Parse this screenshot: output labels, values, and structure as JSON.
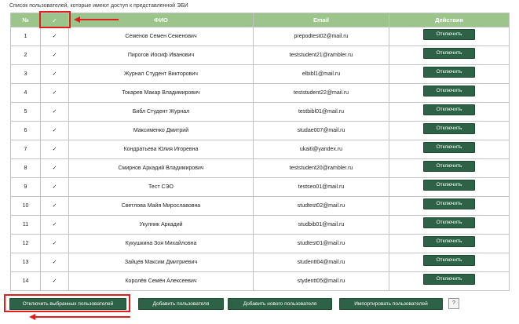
{
  "caption": "Список пользователей, которые имеют доступ к представленной ЭБИ",
  "table": {
    "headers": {
      "num": "№",
      "select_all": "✓",
      "fio": "ФИО",
      "email": "Email",
      "actions": "Действия"
    },
    "rows": [
      {
        "num": "1",
        "checked": "✓",
        "fio": "Семенов Семен Семенович",
        "email": "prepodtest02@mail.ru",
        "action": "Отключить"
      },
      {
        "num": "2",
        "checked": "✓",
        "fio": "Пирогов Иосиф Иванович",
        "email": "teststudent21@rambler.ru",
        "action": "Отключить"
      },
      {
        "num": "3",
        "checked": "✓",
        "fio": "Журнал Студент Викторович",
        "email": "elbibl1@mail.ru",
        "action": "Отключить"
      },
      {
        "num": "4",
        "checked": "✓",
        "fio": "Токарев Макар Владимирович",
        "email": "teststudent22@mail.ru",
        "action": "Отключить"
      },
      {
        "num": "5",
        "checked": "✓",
        "fio": "Библ Студент Журнал",
        "email": "testbibl01@mail.ru",
        "action": "Отключить"
      },
      {
        "num": "6",
        "checked": "✓",
        "fio": "Максименко Дмитрий",
        "email": "studae007@mail.ru",
        "action": "Отключить"
      },
      {
        "num": "7",
        "checked": "✓",
        "fio": "Кондратьева Юлия Игоревна",
        "email": "ukaiti@yandex.ru",
        "action": "Отключить"
      },
      {
        "num": "8",
        "checked": "✓",
        "fio": "Смирнов Аркадий Владимирович",
        "email": "teststudent20@rambler.ru",
        "action": "Отключить"
      },
      {
        "num": "9",
        "checked": "✓",
        "fio": "Тест СЭО",
        "email": "testseo01@mail.ru",
        "action": "Отключить"
      },
      {
        "num": "10",
        "checked": "✓",
        "fio": "Светлова Майя Мирославовна",
        "email": "studtest02@mail.ru",
        "action": "Отключить"
      },
      {
        "num": "11",
        "checked": "✓",
        "fio": "Укулник Аркадий",
        "email": "studbib01@mail.ru",
        "action": "Отключить"
      },
      {
        "num": "12",
        "checked": "✓",
        "fio": "Кукушкина Зоя Михайловна",
        "email": "studtest01@mail.ru",
        "action": "Отключить"
      },
      {
        "num": "13",
        "checked": "✓",
        "fio": "Зайцев Максим Дмитриевич",
        "email": "studentt04@mail.ru",
        "action": "Отключить"
      },
      {
        "num": "14",
        "checked": "✓",
        "fio": "Королёв Семён Алексеевич",
        "email": "stydentt05@mail.ru",
        "action": "Отключить"
      }
    ]
  },
  "bottom_buttons": {
    "disable_selected": "Отключить выбранных пользователей",
    "add_user": "Добавить пользователя",
    "add_new_user": "Добавить нового пользователя",
    "import_users": "Импортировать пользователей",
    "help": "?"
  },
  "colors": {
    "header_bg": "#9bc58b",
    "button_bg": "#2e6246",
    "highlight": "#e01e1e"
  }
}
